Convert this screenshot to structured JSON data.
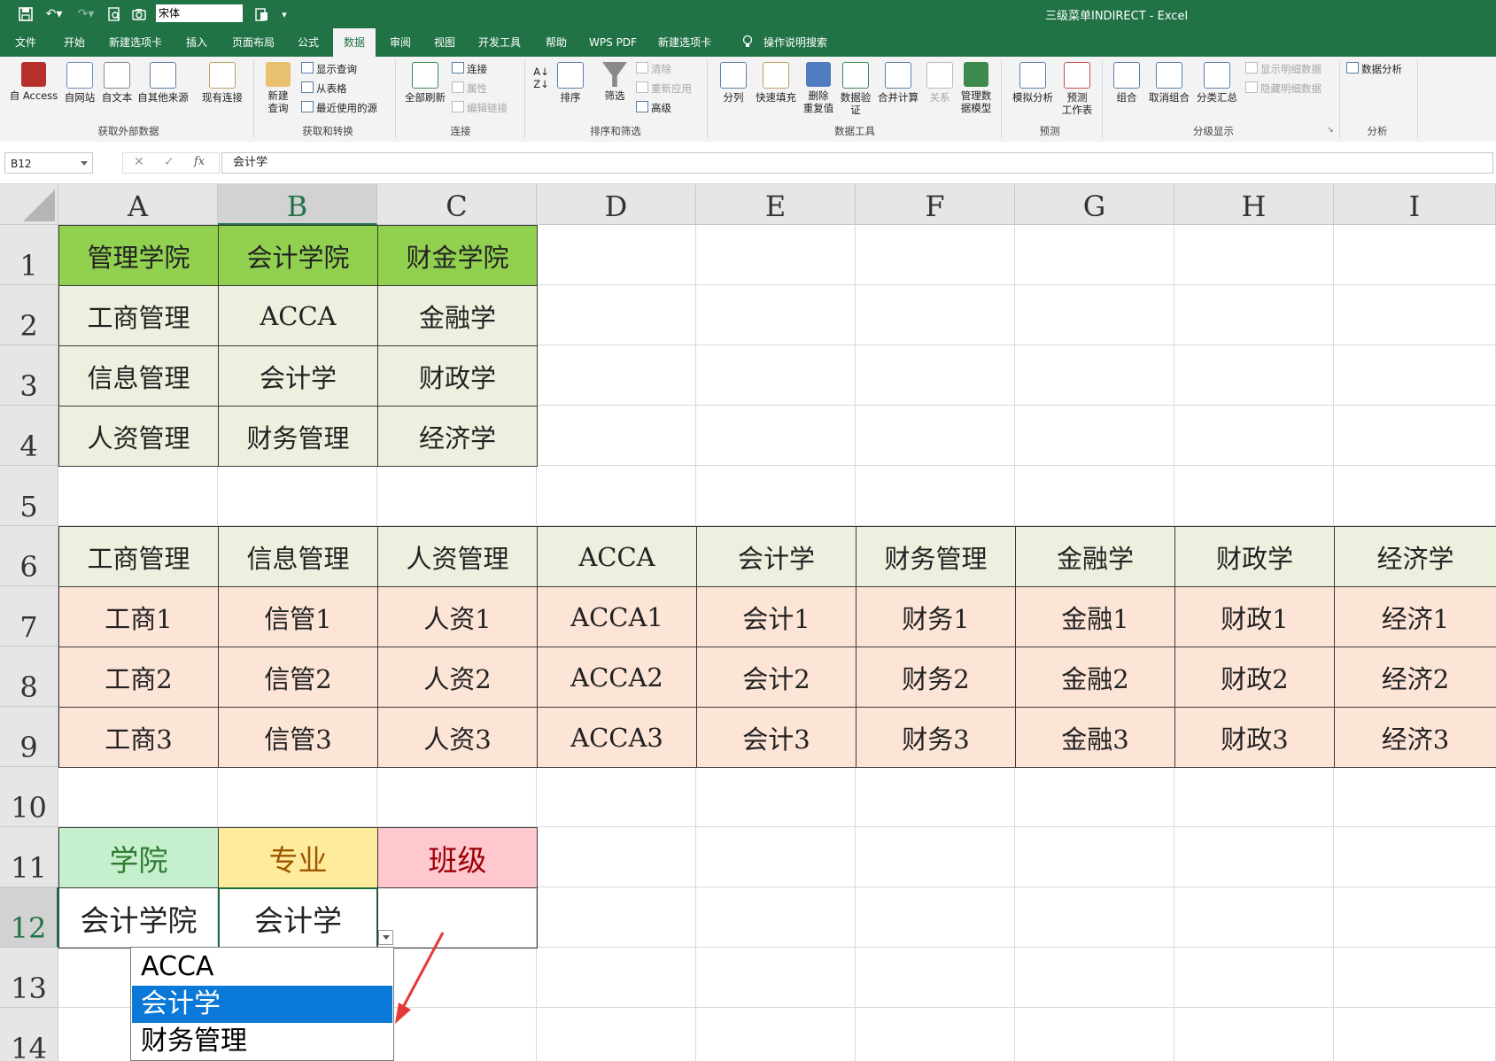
{
  "titlebar": {
    "font_name": "宋体",
    "window_title": "三级菜单INDIRECT  -  Excel"
  },
  "menu_tabs": [
    "文件",
    "开始",
    "新建选项卡",
    "插入",
    "页面布局",
    "公式",
    "数据",
    "审阅",
    "视图",
    "开发工具",
    "帮助",
    "WPS PDF",
    "新建选项卡",
    "操作说明搜索"
  ],
  "active_tab": "数据",
  "ribbon": {
    "get_external": {
      "label": "获取外部数据",
      "buttons": [
        "自 Access",
        "自网站",
        "自文本",
        "自其他来源",
        "现有连接"
      ]
    },
    "get_transform": {
      "label": "获取和转换",
      "new_query": "新建\n查询",
      "items": [
        "显示查询",
        "从表格",
        "最近使用的源"
      ]
    },
    "connections": {
      "label": "连接",
      "refresh_all": "全部刷新",
      "items": [
        "连接",
        "属性",
        "编辑链接"
      ]
    },
    "sort_filter": {
      "label": "排序和筛选",
      "sort": "排序",
      "filter": "筛选",
      "items": [
        "清除",
        "重新应用",
        "高级"
      ]
    },
    "data_tools": {
      "label": "数据工具",
      "buttons": [
        "分列",
        "快速填充",
        "删除\n重复值",
        "数据验\n证",
        "合并计算",
        "关系",
        "管理数\n据模型"
      ]
    },
    "forecast": {
      "label": "预测",
      "buttons": [
        "模拟分析",
        "预测\n工作表"
      ]
    },
    "outline": {
      "label": "分级显示",
      "buttons": [
        "组合",
        "取消组合",
        "分类汇总"
      ],
      "items": [
        "显示明细数据",
        "隐藏明细数据"
      ]
    },
    "analysis": {
      "label": "分析",
      "items": [
        "数据分析"
      ]
    }
  },
  "formula_bar": {
    "name_box": "B12",
    "fx": "fx",
    "formula": "会计学"
  },
  "columns": [
    "A",
    "B",
    "C",
    "D",
    "E",
    "F",
    "G",
    "H",
    "I"
  ],
  "rows": [
    "1",
    "2",
    "3",
    "4",
    "5",
    "6",
    "7",
    "8",
    "9",
    "10",
    "11",
    "12",
    "13",
    "14"
  ],
  "selected_col": "B",
  "selected_row": "12",
  "sheet": {
    "colleges": [
      "管理学院",
      "会计学院",
      "财金学院"
    ],
    "majors_table": [
      [
        "工商管理",
        "ACCA",
        "金融学"
      ],
      [
        "信息管理",
        "会计学",
        "财政学"
      ],
      [
        "人资管理",
        "财务管理",
        "经济学"
      ]
    ],
    "majors_header": [
      "工商管理",
      "信息管理",
      "人资管理",
      "ACCA",
      "会计学",
      "财务管理",
      "金融学",
      "财政学",
      "经济学"
    ],
    "classes": [
      [
        "工商1",
        "信管1",
        "人资1",
        "ACCA1",
        "会计1",
        "财务1",
        "金融1",
        "财政1",
        "经济1"
      ],
      [
        "工商2",
        "信管2",
        "人资2",
        "ACCA2",
        "会计2",
        "财务2",
        "金融2",
        "财政2",
        "经济2"
      ],
      [
        "工商3",
        "信管3",
        "人资3",
        "ACCA3",
        "会计3",
        "财务3",
        "金融3",
        "财政3",
        "经济3"
      ]
    ],
    "selector_headers": [
      "学院",
      "专业",
      "班级"
    ],
    "selector_colors": {
      "college_bg": "#c6efce",
      "college_fg": "#2e7d32",
      "major_bg": "#ffeb9c",
      "major_fg": "#9c5700",
      "class_bg": "#ffc7ce",
      "class_fg": "#9c0006"
    },
    "selector_values": [
      "会计学院",
      "会计学",
      ""
    ]
  },
  "dropdown": {
    "options": [
      "ACCA",
      "会计学",
      "财务管理"
    ],
    "highlighted": "会计学"
  },
  "colors": {
    "excel_green": "#217346",
    "header_green": "#92d050",
    "light_green": "#ebf1de",
    "peach": "#fce4d6",
    "highlight_blue": "#0a78d7",
    "annotation_red": "#e53935"
  }
}
